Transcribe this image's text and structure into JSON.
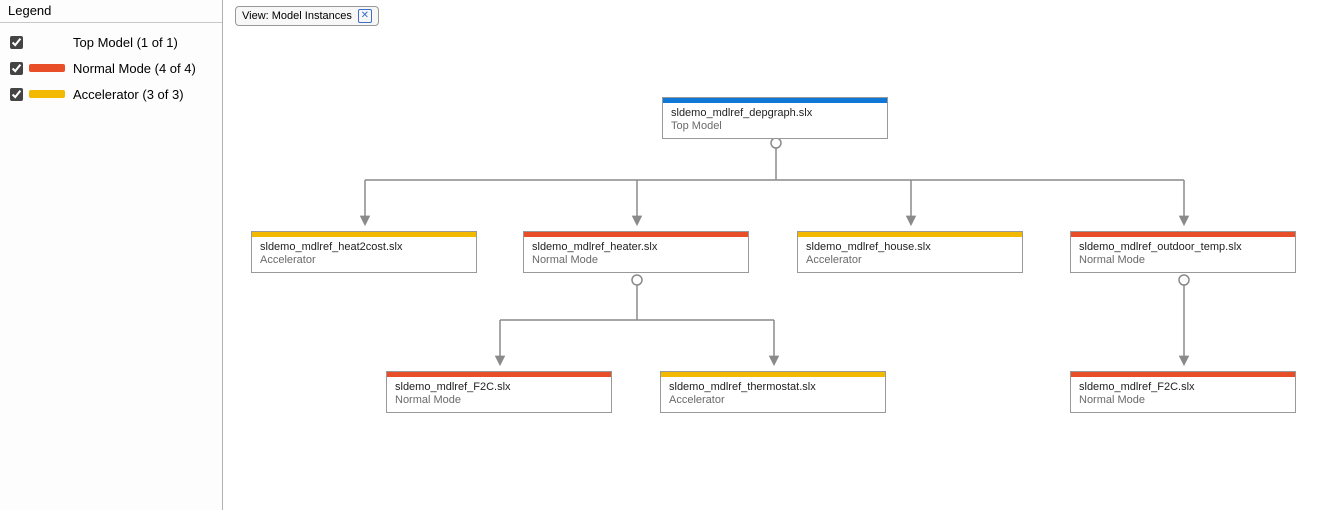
{
  "legend": {
    "title": "Legend",
    "items": [
      {
        "label": "Top Model (1 of 1)",
        "color": "#0f77d6",
        "checked": true
      },
      {
        "label": "Normal Mode (4 of 4)",
        "color": "#e84f29",
        "checked": true
      },
      {
        "label": "Accelerator (3 of 3)",
        "color": "#f2b900",
        "checked": true
      }
    ]
  },
  "view_chip": {
    "label": "View: Model Instances"
  },
  "colors": {
    "top": "#0f77d6",
    "normal": "#e84f29",
    "accel": "#f2b900"
  },
  "nodes": {
    "root": {
      "title": "sldemo_mdlref_depgraph.slx",
      "sub": "Top Model",
      "accent": "top"
    },
    "heat2cost": {
      "title": "sldemo_mdlref_heat2cost.slx",
      "sub": "Accelerator",
      "accent": "accel"
    },
    "heater": {
      "title": "sldemo_mdlref_heater.slx",
      "sub": "Normal Mode",
      "accent": "normal"
    },
    "house": {
      "title": "sldemo_mdlref_house.slx",
      "sub": "Accelerator",
      "accent": "accel"
    },
    "outdoor": {
      "title": "sldemo_mdlref_outdoor_temp.slx",
      "sub": "Normal Mode",
      "accent": "normal"
    },
    "f2c_left": {
      "title": "sldemo_mdlref_F2C.slx",
      "sub": "Normal Mode",
      "accent": "normal"
    },
    "thermostat": {
      "title": "sldemo_mdlref_thermostat.slx",
      "sub": "Accelerator",
      "accent": "accel"
    },
    "f2c_right": {
      "title": "sldemo_mdlref_F2C.slx",
      "sub": "Normal Mode",
      "accent": "normal"
    }
  }
}
